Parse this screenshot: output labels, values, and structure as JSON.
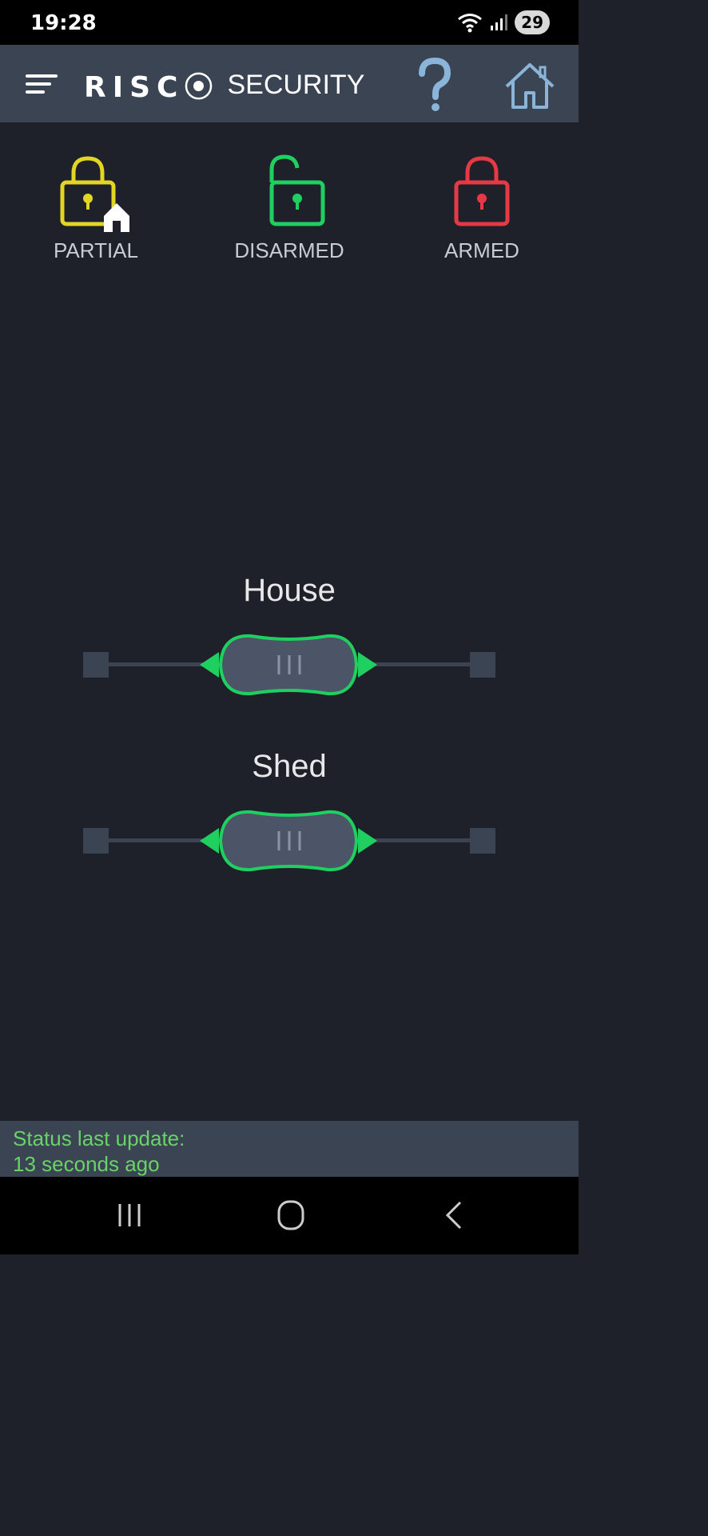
{
  "status_bar": {
    "time": "19:28",
    "battery": "29"
  },
  "app_bar": {
    "logo_word": "RISC⦿",
    "logo_sub": "SECURITY"
  },
  "modes": [
    {
      "label": "PARTIAL",
      "color": "#e2d523"
    },
    {
      "label": "DISARMED",
      "color": "#1fcf5f"
    },
    {
      "label": "ARMED",
      "color": "#e63946"
    }
  ],
  "partitions": [
    {
      "name": "House",
      "state_color": "#1fcf5f"
    },
    {
      "name": "Shed",
      "state_color": "#1fcf5f"
    }
  ],
  "footer": {
    "line1": "Status last update:",
    "line2": "13 seconds ago"
  },
  "colors": {
    "background": "#1e2129",
    "app_bar": "#3a4452",
    "accent_icon": "#8ab4d8",
    "status_text": "#69d368"
  }
}
